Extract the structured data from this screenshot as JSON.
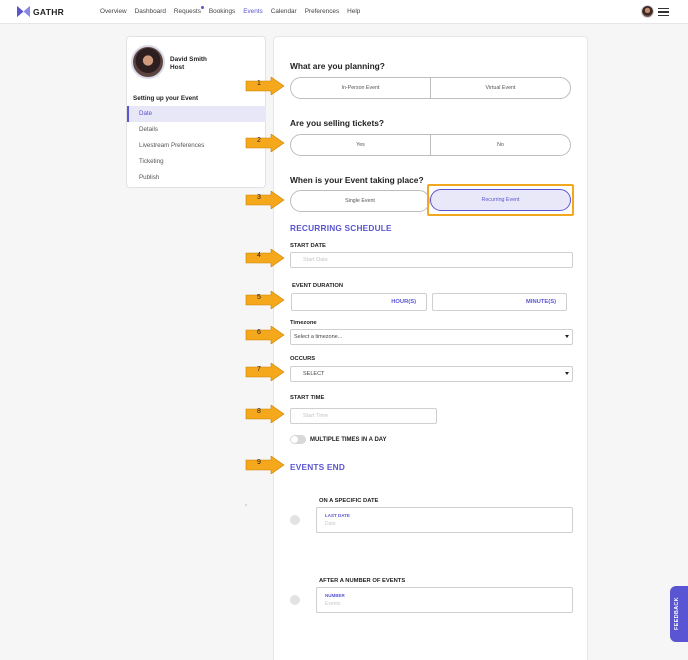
{
  "brand": {
    "name": "GATHR",
    "accent": "#5a55d2",
    "highlight": "#f1a81e",
    "arrow_color": "#f5a81b"
  },
  "nav": {
    "items": [
      {
        "label": "Overview",
        "active": false,
        "dot": false
      },
      {
        "label": "Dashboard",
        "active": false,
        "dot": false
      },
      {
        "label": "Requests",
        "active": false,
        "dot": true
      },
      {
        "label": "Bookings",
        "active": false,
        "dot": false
      },
      {
        "label": "Events",
        "active": true,
        "dot": false
      },
      {
        "label": "Calendar",
        "active": false,
        "dot": false
      },
      {
        "label": "Preferences",
        "active": false,
        "dot": false
      },
      {
        "label": "Help",
        "active": false,
        "dot": false
      }
    ]
  },
  "sidebar": {
    "name": "David Smith",
    "role": "Host",
    "heading": "Setting up your Event",
    "items": [
      {
        "label": "Date",
        "active": true
      },
      {
        "label": "Details",
        "active": false
      },
      {
        "label": "Livestream Preferences",
        "active": false
      },
      {
        "label": "Ticketing",
        "active": false
      },
      {
        "label": "Publish",
        "active": false
      }
    ]
  },
  "form": {
    "planning": {
      "question": "What are you planning?",
      "options": [
        "In-Person Event",
        "Virtual Event"
      ]
    },
    "tickets": {
      "question": "Are you selling tickets?",
      "options": [
        "Yes",
        "No"
      ]
    },
    "when": {
      "question": "When is your Event taking place?",
      "options": [
        "Single Event",
        "Recurring Event"
      ],
      "selected": "Recurring Event"
    },
    "recurring_title": "RECURRING SCHEDULE",
    "start_date": {
      "label": "START DATE",
      "placeholder": "Start Date"
    },
    "duration": {
      "label": "EVENT DURATION",
      "hours_unit": "HOUR(S)",
      "minutes_unit": "MINUTE(S)"
    },
    "timezone": {
      "label": "Timezone",
      "value": "Select a timezone..."
    },
    "occurs": {
      "label": "OCCURS",
      "value": "SELECT"
    },
    "start_time": {
      "label": "START TIME",
      "placeholder": "Start Time"
    },
    "multiple_times": {
      "label": "MULTIPLE TIMES IN A DAY",
      "on": false
    },
    "events_end": {
      "title": "EVENTS END",
      "specific_date": {
        "label": "ON A SPECIFIC DATE",
        "field_label": "LAST DATE",
        "placeholder": "Date"
      },
      "number": {
        "label": "AFTER A NUMBER OF EVENTS",
        "field_label": "NUMBER",
        "placeholder": "Events"
      }
    }
  },
  "annotations": [
    "1",
    "2",
    "3",
    "4",
    "5",
    "6",
    "7",
    "8",
    "9"
  ],
  "feedback_label": "FEEDBACK"
}
